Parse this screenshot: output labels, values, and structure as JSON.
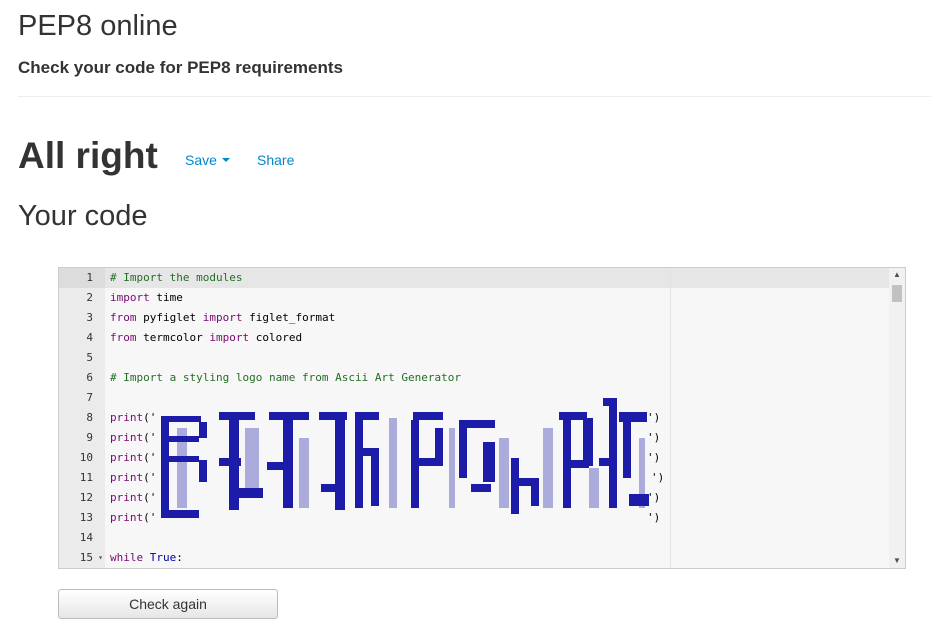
{
  "header": {
    "title": "PEP8 online",
    "subtitle": "Check your code for PEP8 requirements"
  },
  "result": {
    "title": "All right",
    "save_label": "Save",
    "share_label": "Share"
  },
  "section": {
    "title": "Your code"
  },
  "editor": {
    "gutter": [
      "1",
      "2",
      "3",
      "4",
      "5",
      "6",
      "7",
      "8",
      "9",
      "10",
      "11",
      "12",
      "13",
      "14",
      "15"
    ],
    "fold_marker": "▾",
    "lines": {
      "l1": [
        {
          "t": "# Import the modules",
          "c": "cm"
        }
      ],
      "l2": [
        {
          "t": "import",
          "c": "kw"
        },
        {
          "t": " time",
          "c": ""
        }
      ],
      "l3": [
        {
          "t": "from",
          "c": "kw"
        },
        {
          "t": " pyfiglet ",
          "c": ""
        },
        {
          "t": "import",
          "c": "kw"
        },
        {
          "t": " figlet_format",
          "c": ""
        }
      ],
      "l4": [
        {
          "t": "from",
          "c": "kw"
        },
        {
          "t": " termcolor ",
          "c": ""
        },
        {
          "t": "import",
          "c": "kw"
        },
        {
          "t": " colored",
          "c": ""
        }
      ],
      "l6": [
        {
          "t": "# Import a styling logo name from Ascii Art Generator",
          "c": "cm"
        }
      ],
      "l8": [
        {
          "t": "print",
          "c": "kw"
        },
        {
          "t": "('",
          "c": ""
        }
      ],
      "l9": [
        {
          "t": "print",
          "c": "kw"
        },
        {
          "t": "('",
          "c": ""
        }
      ],
      "l10": [
        {
          "t": "print",
          "c": "kw"
        },
        {
          "t": "('",
          "c": ""
        }
      ],
      "l11": [
        {
          "t": "print",
          "c": "kw"
        },
        {
          "t": "('",
          "c": ""
        }
      ],
      "l12": [
        {
          "t": "print",
          "c": "kw"
        },
        {
          "t": "('",
          "c": ""
        }
      ],
      "l13": [
        {
          "t": "print",
          "c": "kw"
        },
        {
          "t": "('",
          "c": ""
        }
      ],
      "l15": [
        {
          "t": "while",
          "c": "kw"
        },
        {
          "t": " ",
          "c": ""
        },
        {
          "t": "True",
          "c": "bi"
        },
        {
          "t": ":",
          "c": ""
        }
      ]
    },
    "print_closers": [
      "')",
      "')",
      "')",
      "')",
      "')",
      "')"
    ],
    "ascii_color": "#1c1ca8",
    "comment_color": "#236e24",
    "keyword_color": "#7a0874"
  },
  "button": {
    "check_again": "Check again"
  }
}
